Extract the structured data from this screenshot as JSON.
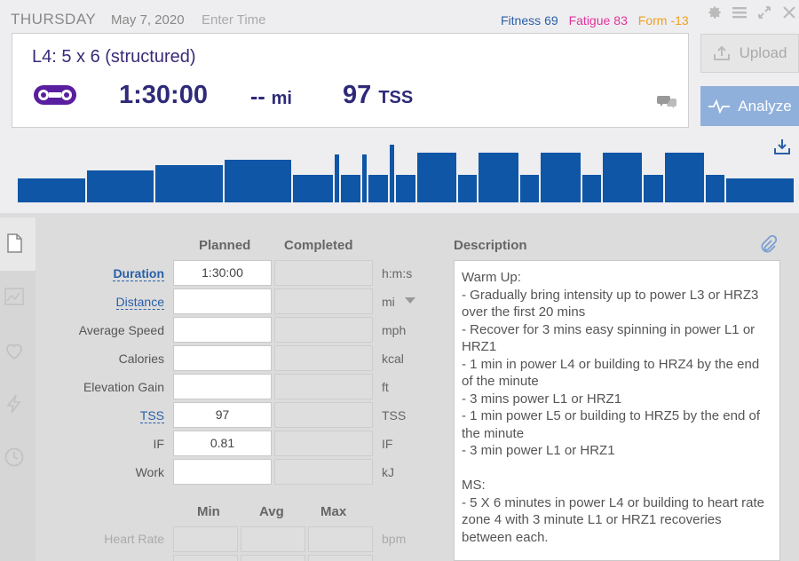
{
  "header": {
    "day": "THURSDAY",
    "date": "May 7, 2020",
    "time_placeholder": "Enter Time",
    "fitness_label": "Fitness",
    "fitness_value": "69",
    "fatigue_label": "Fatigue",
    "fatigue_value": "83",
    "form_label": "Form",
    "form_value": "-13"
  },
  "icons": [
    "gear-icon",
    "menu-icon",
    "expand-icon",
    "close-icon",
    "bike-chain-icon",
    "comment-icon",
    "upload-icon",
    "analyze-pulse-icon",
    "download-icon",
    "document-icon",
    "chart-icon",
    "heart-icon",
    "lightning-icon",
    "clock-icon",
    "paperclip-icon"
  ],
  "workout": {
    "title": "L4: 5 x 6 (structured)",
    "duration": "1:30:00",
    "distance": "--",
    "distance_unit": "mi",
    "tss": "97",
    "tss_unit": "TSS"
  },
  "buttons": {
    "upload": "Upload",
    "analyze": "Analyze"
  },
  "colors": {
    "accent": "#2e2a78",
    "bars": "#0f56a6",
    "analyze": "#8fb0db",
    "fitness": "#2a5fa8",
    "fatigue": "#e0349c",
    "form": "#f0a020",
    "bike": "#5a1ea0"
  },
  "intervals": [
    {
      "minutes": 10,
      "level": 0.4
    },
    {
      "minutes": 10,
      "level": 0.53
    },
    {
      "minutes": 10,
      "level": 0.62
    },
    {
      "minutes": 10,
      "level": 0.7
    },
    {
      "minutes": 6,
      "level": 0.45
    },
    {
      "minutes": 1,
      "level": 0.8
    },
    {
      "minutes": 3,
      "level": 0.45
    },
    {
      "minutes": 1,
      "level": 0.8
    },
    {
      "minutes": 3,
      "level": 0.45
    },
    {
      "minutes": 1,
      "level": 0.95
    },
    {
      "minutes": 3,
      "level": 0.45
    },
    {
      "minutes": 6,
      "level": 0.83
    },
    {
      "minutes": 3,
      "level": 0.45
    },
    {
      "minutes": 6,
      "level": 0.83
    },
    {
      "minutes": 3,
      "level": 0.45
    },
    {
      "minutes": 6,
      "level": 0.83
    },
    {
      "minutes": 3,
      "level": 0.45
    },
    {
      "minutes": 6,
      "level": 0.83
    },
    {
      "minutes": 3,
      "level": 0.45
    },
    {
      "minutes": 6,
      "level": 0.83
    },
    {
      "minutes": 3,
      "level": 0.45
    },
    {
      "minutes": 10,
      "level": 0.4
    }
  ],
  "form": {
    "planned_header": "Planned",
    "completed_header": "Completed",
    "rows": [
      {
        "label": "Duration",
        "planned": "1:30:00",
        "unit": "h:m:s"
      },
      {
        "label": "Distance",
        "planned": "",
        "unit": "mi"
      },
      {
        "label": "Average Speed",
        "planned": "",
        "unit": "mph"
      },
      {
        "label": "Calories",
        "planned": "",
        "unit": "kcal"
      },
      {
        "label": "Elevation Gain",
        "planned": "",
        "unit": "ft"
      },
      {
        "label": "TSS",
        "planned": "97",
        "unit": "TSS"
      },
      {
        "label": "IF",
        "planned": "0.81",
        "unit": "IF"
      },
      {
        "label": "Work",
        "planned": "",
        "unit": "kJ"
      }
    ],
    "min_header": "Min",
    "avg_header": "Avg",
    "max_header": "Max",
    "heart_rate_label": "Heart Rate",
    "heart_rate_unit": "bpm"
  },
  "description": {
    "header": "Description",
    "text": "Warm Up:\n- Gradually bring intensity up to power L3 or HRZ3 over the first 20 mins\n- Recover for 3 mins easy spinning in power L1 or HRZ1\n- 1 min in power L4 or building to HRZ4 by the end of the minute\n- 3 mins power L1 or HRZ1\n- 1 min power L5 or building to HRZ5 by the end of the minute\n- 3 min power L1 or HRZ1\n\nMS:\n- 5 X 6 minutes in power L4 or building to heart rate zone 4 with 3 minute L1 or HRZ1 recoveries between each."
  }
}
